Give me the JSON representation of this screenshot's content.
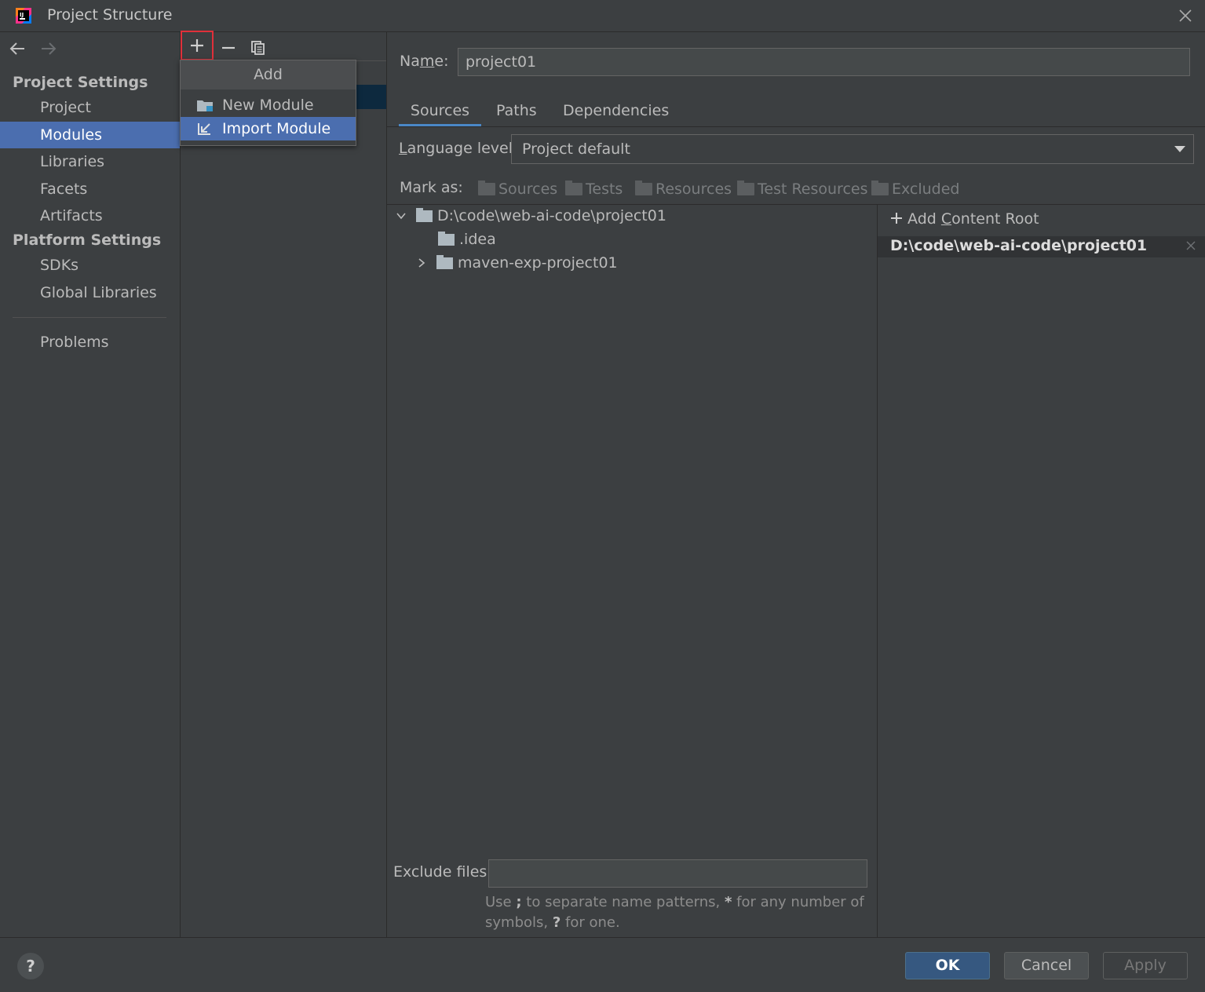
{
  "window": {
    "title": "Project Structure"
  },
  "sidebar": {
    "project_settings_header": "Project Settings",
    "platform_settings_header": "Platform Settings",
    "items": [
      {
        "label": "Project"
      },
      {
        "label": "Modules"
      },
      {
        "label": "Libraries"
      },
      {
        "label": "Facets"
      },
      {
        "label": "Artifacts"
      },
      {
        "label": "SDKs"
      },
      {
        "label": "Global Libraries"
      },
      {
        "label": "Problems"
      }
    ],
    "selected": "Modules"
  },
  "toolbar": {
    "add_icon": "plus-icon",
    "remove_icon": "minus-icon",
    "copy_icon": "copy-icon"
  },
  "add_popup": {
    "title": "Add",
    "items": [
      {
        "label": "New Module",
        "icon": "new-module-icon"
      },
      {
        "label": "Import Module",
        "icon": "import-module-icon"
      }
    ],
    "selected": "Import Module"
  },
  "module": {
    "name_label": "Name:",
    "name_value": "project01",
    "tabs": [
      {
        "label": "Sources"
      },
      {
        "label": "Paths"
      },
      {
        "label": "Dependencies"
      }
    ],
    "active_tab": "Sources",
    "language_level_label": "Language level:",
    "language_level_value": "Project default",
    "mark_as_label": "Mark as:",
    "mark_as": [
      "Sources",
      "Tests",
      "Resources",
      "Test Resources",
      "Excluded"
    ],
    "tree": [
      {
        "label": "D:\\code\\web-ai-code\\project01",
        "expanded": true
      },
      {
        "label": ".idea"
      },
      {
        "label": "maven-exp-project01",
        "expanded": false
      }
    ],
    "add_content_root": "Add Content Root",
    "content_root": "D:\\code\\web-ai-code\\project01",
    "exclude_label": "Exclude files:",
    "exclude_value": "",
    "exclude_hint_1": "Use ",
    "exclude_hint_semicolon": ";",
    "exclude_hint_2": " to separate name patterns, ",
    "exclude_hint_star": "*",
    "exclude_hint_3": " for any number of symbols, ",
    "exclude_hint_q": "?",
    "exclude_hint_4": " for one."
  },
  "footer": {
    "help": "?",
    "ok": "OK",
    "cancel": "Cancel",
    "apply": "Apply"
  },
  "colors": {
    "background": "#3c3f41",
    "selection": "#4b6eaf",
    "ok_button": "#365880",
    "highlight_border": "#e0303a"
  }
}
